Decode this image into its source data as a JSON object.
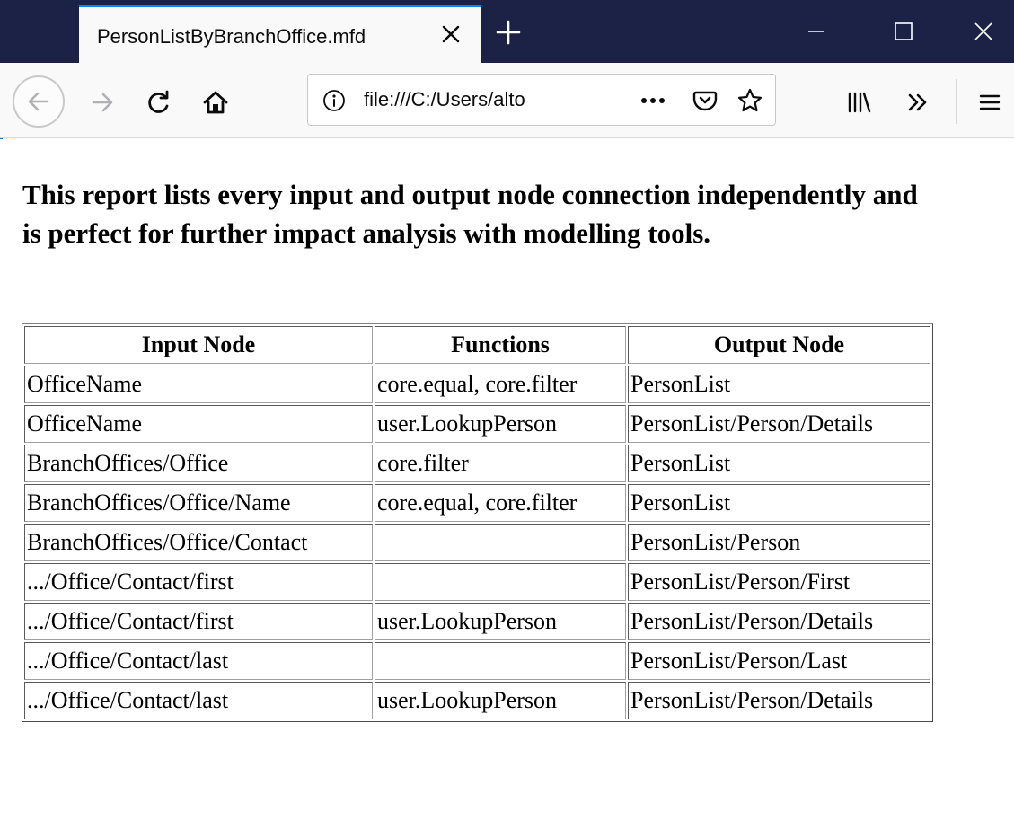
{
  "browser": {
    "tab": {
      "title": "PersonListByBranchOffice.mfd"
    },
    "address_bar": {
      "url": "file:///C:/Users/alto"
    },
    "icons": {
      "back": "back-arrow-icon",
      "forward": "forward-arrow-icon",
      "reload": "reload-icon",
      "home": "home-icon",
      "info": "info-icon",
      "page_actions": "ellipsis-icon",
      "pocket": "pocket-icon",
      "bookmark": "star-icon",
      "library": "library-icon",
      "overflow": "chevron-double-right-icon",
      "menu": "hamburger-menu-icon",
      "close_tab": "close-icon",
      "new_tab": "plus-icon"
    },
    "colors": {
      "tab_strip": "#1c2245",
      "active_tab_accent": "#0a84ff"
    }
  },
  "report": {
    "heading": "This report lists every input and output node connection independently and is perfect for further impact analysis with modelling tools.",
    "columns": [
      "Input Node",
      "Functions",
      "Output Node"
    ],
    "rows": [
      [
        "OfficeName",
        "core.equal, core.filter",
        "PersonList"
      ],
      [
        "OfficeName",
        "user.LookupPerson",
        "PersonList/Person/Details"
      ],
      [
        "BranchOffices/Office",
        "core.filter",
        "PersonList"
      ],
      [
        "BranchOffices/Office/Name",
        "core.equal, core.filter",
        "PersonList"
      ],
      [
        "BranchOffices/Office/Contact",
        "",
        "PersonList/Person"
      ],
      [
        ".../Office/Contact/first",
        "",
        "PersonList/Person/First"
      ],
      [
        ".../Office/Contact/first",
        "user.LookupPerson",
        "PersonList/Person/Details"
      ],
      [
        ".../Office/Contact/last",
        "",
        "PersonList/Person/Last"
      ],
      [
        ".../Office/Contact/last",
        "user.LookupPerson",
        "PersonList/Person/Details"
      ]
    ]
  }
}
